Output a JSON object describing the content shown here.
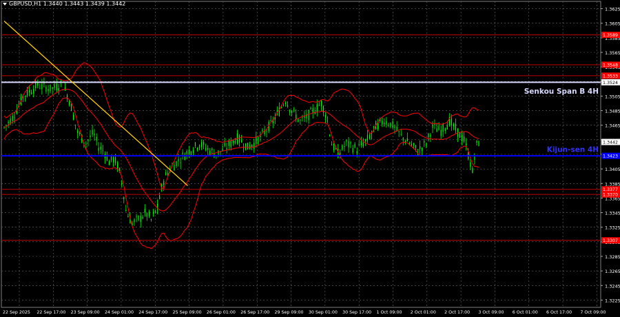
{
  "header": {
    "title": "GBPUSD,H1  1.3440 1.3443 1.3439 1.3442"
  },
  "colors": {
    "background": "#000000",
    "grid": "#6a6a6a",
    "candle": "#00ff00",
    "bands": "#ff0000",
    "trendline": "#ffcc00",
    "kijun": "#0000ff",
    "senkou": "#d8d8ff",
    "levels": "#c00000",
    "price_label": "#ff0000",
    "axis_text": "#ffffff"
  },
  "chart_data": {
    "type": "candlestick",
    "symbol": "GBPUSD",
    "timeframe": "H1",
    "ylim": [
      1.3215,
      1.3635
    ],
    "y_ticks": [
      "1.3625",
      "1.3605",
      "1.3585",
      "1.3565",
      "1.3545",
      "1.3525",
      "1.3505",
      "1.3485",
      "1.3465",
      "1.3445",
      "1.3425",
      "1.3405",
      "1.3385",
      "1.3365",
      "1.3345",
      "1.3325",
      "1.3305",
      "1.3285",
      "1.3265",
      "1.3245",
      "1.3225"
    ],
    "x_ticks": [
      "22 Sep 2025",
      "22 Sep 17:00",
      "23 Sep 09:00",
      "24 Sep 01:00",
      "24 Sep 17:00",
      "25 Sep 09:00",
      "26 Sep 01:00",
      "26 Sep 17:00",
      "29 Sep 09:00",
      "30 Sep 01:00",
      "30 Sep 17:00",
      "1 Oct 09:00",
      "2 Oct 01:00",
      "2 Oct 17:00",
      "3 Oct 09:00",
      "6 Oct 01:00",
      "6 Oct 17:00",
      "7 Oct 09:00"
    ],
    "bars_count": 230,
    "close_path": [
      [
        0,
        1.3462
      ],
      [
        8,
        1.3475
      ],
      [
        18,
        1.3505
      ],
      [
        32,
        1.352
      ],
      [
        45,
        1.3515
      ],
      [
        55,
        1.3522
      ],
      [
        62,
        1.35
      ],
      [
        70,
        1.3455
      ],
      [
        78,
        1.344
      ],
      [
        85,
        1.3455
      ],
      [
        90,
        1.3435
      ],
      [
        95,
        1.343
      ],
      [
        100,
        1.3415
      ],
      [
        105,
        1.342
      ],
      [
        110,
        1.34
      ],
      [
        113,
        1.338
      ],
      [
        116,
        1.3348
      ],
      [
        122,
        1.333
      ],
      [
        130,
        1.3338
      ],
      [
        135,
        1.3345
      ],
      [
        140,
        1.3335
      ],
      [
        146,
        1.3352
      ],
      [
        152,
        1.339
      ],
      [
        158,
        1.3405
      ],
      [
        165,
        1.3415
      ],
      [
        172,
        1.3425
      ],
      [
        178,
        1.3432
      ],
      [
        186,
        1.344
      ],
      [
        194,
        1.3432
      ],
      [
        202,
        1.3425
      ],
      [
        212,
        1.3435
      ],
      [
        222,
        1.3448
      ],
      [
        232,
        1.3435
      ],
      [
        240,
        1.3442
      ],
      [
        248,
        1.3455
      ],
      [
        256,
        1.347
      ],
      [
        262,
        1.3485
      ],
      [
        268,
        1.35
      ],
      [
        274,
        1.3485
      ],
      [
        282,
        1.347
      ],
      [
        290,
        1.3478
      ],
      [
        296,
        1.3487
      ],
      [
        302,
        1.3495
      ],
      [
        307,
        1.3478
      ],
      [
        312,
        1.344
      ],
      [
        318,
        1.3425
      ],
      [
        326,
        1.344
      ],
      [
        336,
        1.3432
      ],
      [
        346,
        1.3445
      ],
      [
        354,
        1.3463
      ],
      [
        362,
        1.3472
      ],
      [
        370,
        1.3465
      ],
      [
        378,
        1.345
      ],
      [
        386,
        1.344
      ],
      [
        394,
        1.343
      ],
      [
        402,
        1.344
      ],
      [
        408,
        1.3462
      ],
      [
        416,
        1.3458
      ],
      [
        424,
        1.347
      ],
      [
        432,
        1.3455
      ],
      [
        438,
        1.3445
      ],
      [
        443,
        1.342
      ],
      [
        446,
        1.34
      ],
      [
        449,
        1.3435
      ],
      [
        452,
        1.3442
      ]
    ],
    "bars_total_slots": 460,
    "horizontal_levels": [
      {
        "price": 1.3589,
        "label": "1.3589",
        "kind": "resistance"
      },
      {
        "price": 1.3548,
        "label": "1.3548",
        "kind": "resistance"
      },
      {
        "price": 1.3533,
        "label": "1.3533",
        "kind": "resistance"
      },
      {
        "price": 1.3524,
        "label": "1.3524",
        "kind": "senkou_span_b"
      },
      {
        "price": 1.3423,
        "label": "1.3423",
        "kind": "kijun_sen"
      },
      {
        "price": 1.3377,
        "label": "1.3377",
        "kind": "support"
      },
      {
        "price": 1.337,
        "label": "1.3370",
        "kind": "support"
      },
      {
        "price": 1.3307,
        "label": "1.3307",
        "kind": "support"
      }
    ],
    "current_price": {
      "price": 1.3442,
      "label": "1.3442"
    },
    "trendline": {
      "from": [
        0,
        1.3608
      ],
      "to": [
        348,
        1.3382
      ]
    },
    "annotations": [
      {
        "text": "Senkou Span B 4H",
        "price": 1.3512,
        "color": "#d8d8ff"
      },
      {
        "text": "Kijun-sen 4H",
        "price": 1.3432,
        "color": "#3030ff"
      }
    ]
  }
}
